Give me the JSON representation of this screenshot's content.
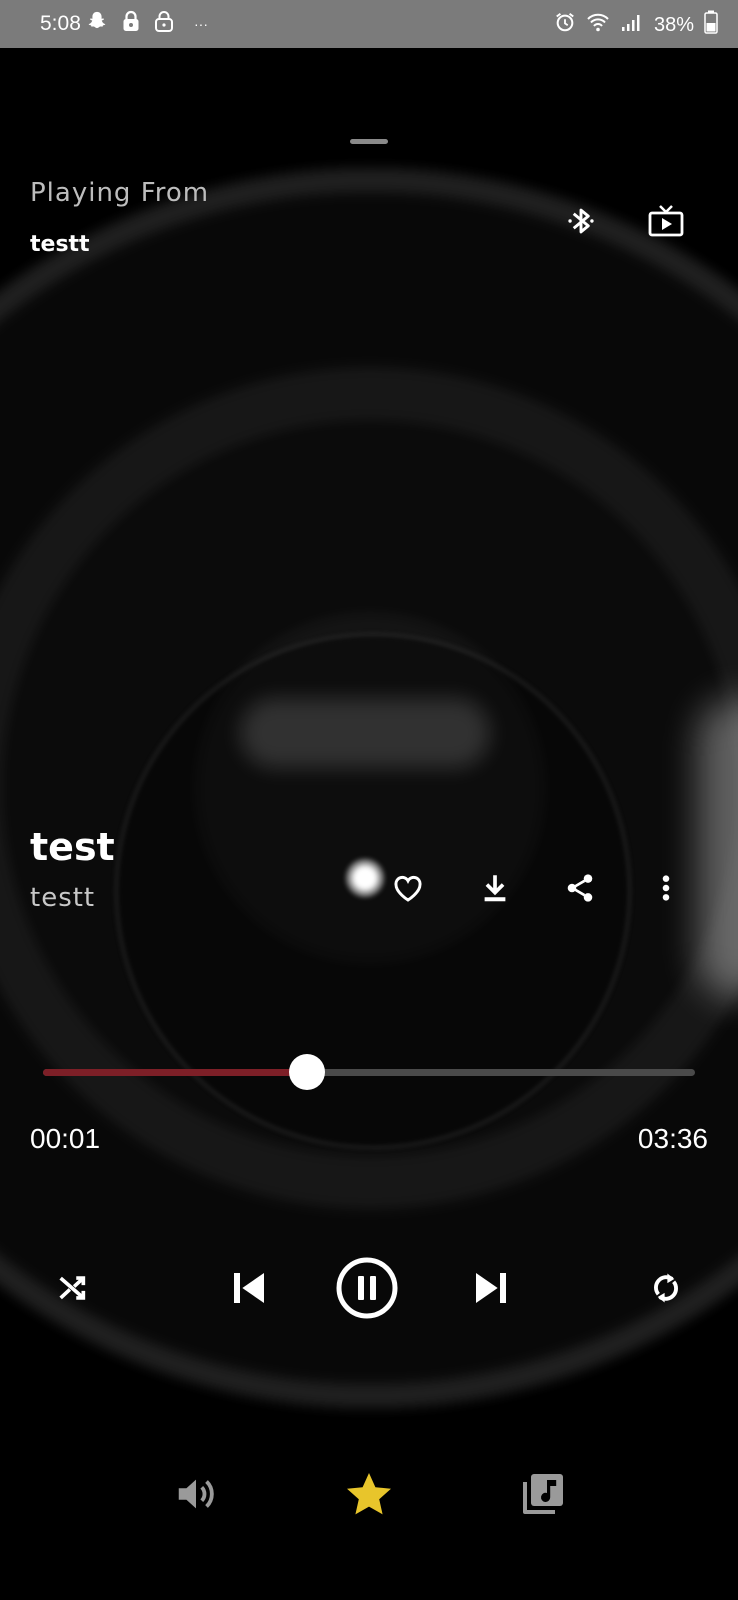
{
  "status_bar": {
    "time": "5:08",
    "battery": "38%",
    "overflow": "···",
    "icons": [
      "snapchat-icon",
      "lock-icon",
      "lock-open-icon",
      "alarm-icon",
      "wifi-icon",
      "signal-icon",
      "battery-icon"
    ]
  },
  "header": {
    "playing_from_label": "Playing From",
    "playlist_name": "testt",
    "actions": [
      "bluetooth-icon",
      "cast-tv-icon"
    ]
  },
  "track": {
    "title": "test",
    "artist": "testt",
    "actions": [
      "heart-icon",
      "download-icon",
      "share-icon",
      "more-vert-icon"
    ]
  },
  "progress": {
    "elapsed": "00:01",
    "total": "03:36",
    "fraction": 0.405,
    "fill_color": "#7d1f27",
    "track_color": "#4a4a4a"
  },
  "controls": {
    "buttons": [
      "shuffle-icon",
      "skip-previous-icon",
      "pause-circle-icon",
      "skip-next-icon",
      "repeat-icon"
    ]
  },
  "bottom_bar": {
    "buttons": [
      "volume-icon",
      "star-icon",
      "queue-music-icon"
    ],
    "star_color": "#e8c52b",
    "icon_color": "#9a9a9a"
  }
}
